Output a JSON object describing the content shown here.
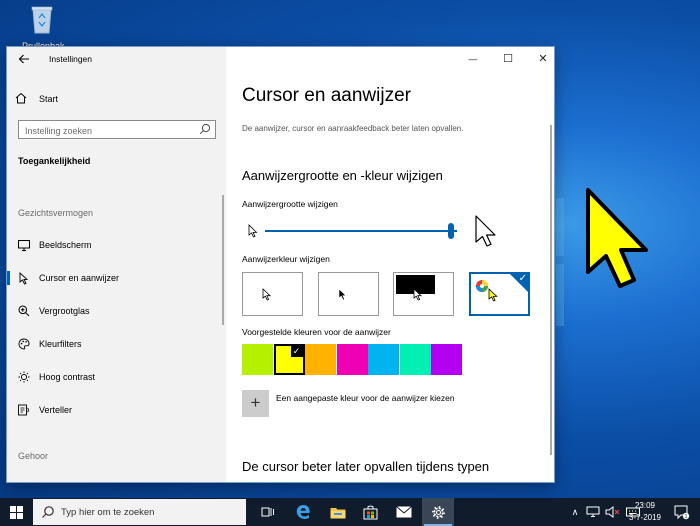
{
  "desktop": {
    "recycle_bin_label": "Prullenbak"
  },
  "window": {
    "app_title": "Instellingen",
    "controls": {
      "minimize": "—",
      "maximize": "☐",
      "close": "✕"
    }
  },
  "sidebar": {
    "home_label": "Start",
    "search_placeholder": "Instelling zoeken",
    "section_title": "Toegankelijkheid",
    "group_vision": "Gezichtsvermogen",
    "items": [
      {
        "label": "Beeldscherm",
        "icon": "monitor-icon"
      },
      {
        "label": "Cursor en aanwijzer",
        "icon": "pointer-icon",
        "active": true
      },
      {
        "label": "Vergrootglas",
        "icon": "magnifier-icon"
      },
      {
        "label": "Kleurfilters",
        "icon": "palette-icon"
      },
      {
        "label": "Hoog contrast",
        "icon": "sun-icon"
      },
      {
        "label": "Verteller",
        "icon": "narrator-icon"
      }
    ],
    "group_hearing": "Gehoor"
  },
  "main": {
    "title": "Cursor en aanwijzer",
    "description": "De aanwijzer, cursor en aanraakfeedback beter laten opvallen.",
    "section_pointer": "Aanwijzergrootte en -kleur wijzigen",
    "size_label": "Aanwijzergrootte wijzigen",
    "size_value_percent": 97,
    "color_label": "Aanwijzerkleur wijzigen",
    "color_options": [
      "white",
      "black",
      "inverted",
      "custom"
    ],
    "selected_color_option": "custom",
    "suggested_label": "Voorgestelde kleuren voor de aanwijzer",
    "suggested_colors": [
      "#b4f000",
      "#ffff00",
      "#ffb300",
      "#f000b4",
      "#00b4f0",
      "#00f0b4",
      "#b400f0"
    ],
    "selected_suggested_index": 1,
    "custom_color_label": "Een aangepaste kleur voor de aanwijzer kiezen",
    "add_symbol": "+",
    "section_cursor": "De cursor beter later opvallen tijdens typen"
  },
  "taskbar": {
    "search_placeholder": "Typ hier om te zoeken",
    "time": "23:09",
    "date": "3-7-2019",
    "tray_chevron": "∧"
  },
  "colors": {
    "accent": "#0063b1",
    "sidebar_bg": "#f2f2f2",
    "pointer_yellow": "#ffff00"
  }
}
